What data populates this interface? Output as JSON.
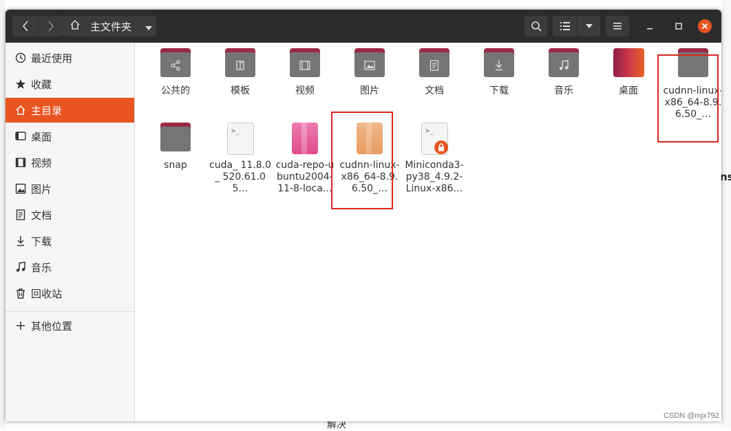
{
  "window": {
    "title": "主文件夹"
  },
  "sidebar": {
    "items": [
      {
        "label": "最近使用",
        "icon": "clock-icon"
      },
      {
        "label": "收藏",
        "icon": "star-icon"
      },
      {
        "label": "主目录",
        "icon": "home-icon",
        "active": true
      },
      {
        "label": "桌面",
        "icon": "desktop-icon"
      },
      {
        "label": "视频",
        "icon": "video-icon"
      },
      {
        "label": "图片",
        "icon": "image-icon"
      },
      {
        "label": "文档",
        "icon": "document-icon"
      },
      {
        "label": "下载",
        "icon": "download-icon"
      },
      {
        "label": "音乐",
        "icon": "music-icon"
      },
      {
        "label": "回收站",
        "icon": "trash-icon"
      }
    ],
    "other_locations": "其他位置"
  },
  "files": [
    {
      "name": "公共的",
      "type": "folder",
      "symbol": "share-icon"
    },
    {
      "name": "模板",
      "type": "folder",
      "symbol": "template-icon"
    },
    {
      "name": "视频",
      "type": "folder",
      "symbol": "video-icon"
    },
    {
      "name": "图片",
      "type": "folder",
      "symbol": "image-icon"
    },
    {
      "name": "文档",
      "type": "folder",
      "symbol": "document-icon"
    },
    {
      "name": "下载",
      "type": "folder",
      "symbol": "download-icon"
    },
    {
      "name": "音乐",
      "type": "folder",
      "symbol": "music-icon"
    },
    {
      "name": "桌面",
      "type": "desktop-folder"
    },
    {
      "name": "cudnn-linux-x86_64-8.9.6.50_…",
      "type": "folder",
      "highlighted": true
    },
    {
      "name": "snap",
      "type": "folder"
    },
    {
      "name": "cuda_ 11.8.0_ 520.61.05…",
      "type": "script"
    },
    {
      "name": "cuda-repo-ubuntu2004-11-8-loca…",
      "type": "deb-package"
    },
    {
      "name": "cudnn-linux-x86_64-8.9.6.50_…",
      "type": "archive",
      "highlighted": true
    },
    {
      "name": "Miniconda3-py38_4.9.2-Linux-x86…",
      "type": "script-locked"
    }
  ],
  "background": {
    "bottom_text": "解决",
    "right_mark": "ns",
    "watermark": "CSDN @mjx792"
  },
  "colors": {
    "accent": "#e95420",
    "folder_tab": "#9c2a45",
    "folder_body": "#757575",
    "header": "#2c2c2c",
    "highlight_box": "#d9251d"
  }
}
